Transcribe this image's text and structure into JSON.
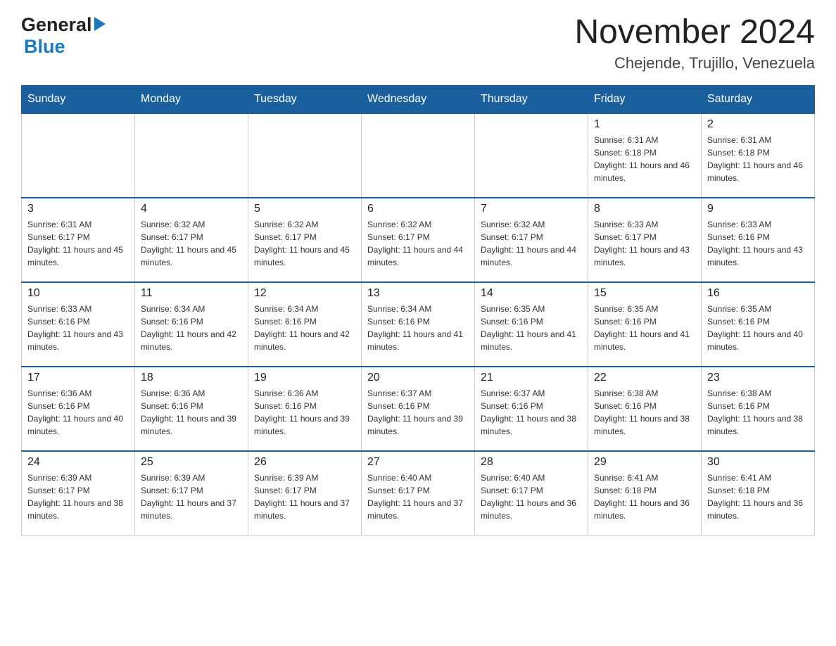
{
  "header": {
    "logo": {
      "general": "General",
      "arrow": "▶",
      "blue": "Blue"
    },
    "title": "November 2024",
    "subtitle": "Chejende, Trujillo, Venezuela"
  },
  "days_of_week": [
    "Sunday",
    "Monday",
    "Tuesday",
    "Wednesday",
    "Thursday",
    "Friday",
    "Saturday"
  ],
  "weeks": [
    [
      {
        "day": "",
        "info": ""
      },
      {
        "day": "",
        "info": ""
      },
      {
        "day": "",
        "info": ""
      },
      {
        "day": "",
        "info": ""
      },
      {
        "day": "",
        "info": ""
      },
      {
        "day": "1",
        "info": "Sunrise: 6:31 AM\nSunset: 6:18 PM\nDaylight: 11 hours and 46 minutes."
      },
      {
        "day": "2",
        "info": "Sunrise: 6:31 AM\nSunset: 6:18 PM\nDaylight: 11 hours and 46 minutes."
      }
    ],
    [
      {
        "day": "3",
        "info": "Sunrise: 6:31 AM\nSunset: 6:17 PM\nDaylight: 11 hours and 45 minutes."
      },
      {
        "day": "4",
        "info": "Sunrise: 6:32 AM\nSunset: 6:17 PM\nDaylight: 11 hours and 45 minutes."
      },
      {
        "day": "5",
        "info": "Sunrise: 6:32 AM\nSunset: 6:17 PM\nDaylight: 11 hours and 45 minutes."
      },
      {
        "day": "6",
        "info": "Sunrise: 6:32 AM\nSunset: 6:17 PM\nDaylight: 11 hours and 44 minutes."
      },
      {
        "day": "7",
        "info": "Sunrise: 6:32 AM\nSunset: 6:17 PM\nDaylight: 11 hours and 44 minutes."
      },
      {
        "day": "8",
        "info": "Sunrise: 6:33 AM\nSunset: 6:17 PM\nDaylight: 11 hours and 43 minutes."
      },
      {
        "day": "9",
        "info": "Sunrise: 6:33 AM\nSunset: 6:16 PM\nDaylight: 11 hours and 43 minutes."
      }
    ],
    [
      {
        "day": "10",
        "info": "Sunrise: 6:33 AM\nSunset: 6:16 PM\nDaylight: 11 hours and 43 minutes."
      },
      {
        "day": "11",
        "info": "Sunrise: 6:34 AM\nSunset: 6:16 PM\nDaylight: 11 hours and 42 minutes."
      },
      {
        "day": "12",
        "info": "Sunrise: 6:34 AM\nSunset: 6:16 PM\nDaylight: 11 hours and 42 minutes."
      },
      {
        "day": "13",
        "info": "Sunrise: 6:34 AM\nSunset: 6:16 PM\nDaylight: 11 hours and 41 minutes."
      },
      {
        "day": "14",
        "info": "Sunrise: 6:35 AM\nSunset: 6:16 PM\nDaylight: 11 hours and 41 minutes."
      },
      {
        "day": "15",
        "info": "Sunrise: 6:35 AM\nSunset: 6:16 PM\nDaylight: 11 hours and 41 minutes."
      },
      {
        "day": "16",
        "info": "Sunrise: 6:35 AM\nSunset: 6:16 PM\nDaylight: 11 hours and 40 minutes."
      }
    ],
    [
      {
        "day": "17",
        "info": "Sunrise: 6:36 AM\nSunset: 6:16 PM\nDaylight: 11 hours and 40 minutes."
      },
      {
        "day": "18",
        "info": "Sunrise: 6:36 AM\nSunset: 6:16 PM\nDaylight: 11 hours and 39 minutes."
      },
      {
        "day": "19",
        "info": "Sunrise: 6:36 AM\nSunset: 6:16 PM\nDaylight: 11 hours and 39 minutes."
      },
      {
        "day": "20",
        "info": "Sunrise: 6:37 AM\nSunset: 6:16 PM\nDaylight: 11 hours and 39 minutes."
      },
      {
        "day": "21",
        "info": "Sunrise: 6:37 AM\nSunset: 6:16 PM\nDaylight: 11 hours and 38 minutes."
      },
      {
        "day": "22",
        "info": "Sunrise: 6:38 AM\nSunset: 6:16 PM\nDaylight: 11 hours and 38 minutes."
      },
      {
        "day": "23",
        "info": "Sunrise: 6:38 AM\nSunset: 6:16 PM\nDaylight: 11 hours and 38 minutes."
      }
    ],
    [
      {
        "day": "24",
        "info": "Sunrise: 6:39 AM\nSunset: 6:17 PM\nDaylight: 11 hours and 38 minutes."
      },
      {
        "day": "25",
        "info": "Sunrise: 6:39 AM\nSunset: 6:17 PM\nDaylight: 11 hours and 37 minutes."
      },
      {
        "day": "26",
        "info": "Sunrise: 6:39 AM\nSunset: 6:17 PM\nDaylight: 11 hours and 37 minutes."
      },
      {
        "day": "27",
        "info": "Sunrise: 6:40 AM\nSunset: 6:17 PM\nDaylight: 11 hours and 37 minutes."
      },
      {
        "day": "28",
        "info": "Sunrise: 6:40 AM\nSunset: 6:17 PM\nDaylight: 11 hours and 36 minutes."
      },
      {
        "day": "29",
        "info": "Sunrise: 6:41 AM\nSunset: 6:18 PM\nDaylight: 11 hours and 36 minutes."
      },
      {
        "day": "30",
        "info": "Sunrise: 6:41 AM\nSunset: 6:18 PM\nDaylight: 11 hours and 36 minutes."
      }
    ]
  ]
}
